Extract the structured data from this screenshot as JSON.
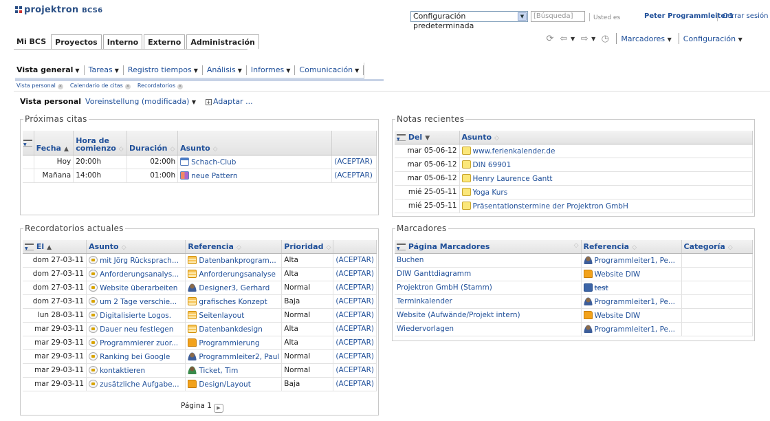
{
  "header": {
    "logo_text": "projektron",
    "logo_suffix": "BCS",
    "logo_version": "6",
    "profile_select": "Configuración predeterminada",
    "search_placeholder": "Búsqueda",
    "user_prefix": "Usted es",
    "user_name": "Peter Programmleiter1",
    "logout": "Cerrar sesión"
  },
  "main_tabs": [
    "Mi BCS",
    "Proyectos",
    "Interno",
    "Externo",
    "Administración"
  ],
  "toolbar": {
    "bookmarks": "Marcadores",
    "settings": "Configuración"
  },
  "subnav": [
    "Vista general",
    "Tareas",
    "Registro tiempos",
    "Análisis",
    "Informes",
    "Comunicación"
  ],
  "breadcrumbs": [
    "Vista personal",
    "Calendario de citas",
    "Recordatorios"
  ],
  "viewbar": {
    "title": "Vista personal",
    "preset": "Voreinstellung (modificada)",
    "adapt": "Adaptar ..."
  },
  "appointments": {
    "title": "Próximas citas",
    "headers": [
      "Fecha",
      "Hora de comienzo",
      "Duración",
      "Asunto"
    ],
    "rows": [
      {
        "date": "Hoy",
        "time": "20:00h",
        "duration": "02:00h",
        "subject": "Schach-Club",
        "action": "(ACEPTAR)"
      },
      {
        "date": "Mañana",
        "time": "14:00h",
        "duration": "01:00h",
        "subject": "neue Pattern",
        "action": "(ACEPTAR)"
      }
    ]
  },
  "notes": {
    "title": "Notas recientes",
    "headers": [
      "Del",
      "Asunto"
    ],
    "rows": [
      {
        "date": "mar 05-06-12",
        "subject": "www.ferienkalender.de"
      },
      {
        "date": "mar 05-06-12",
        "subject": "DIN 69901"
      },
      {
        "date": "mar 05-06-12",
        "subject": "Henry Laurence Gantt"
      },
      {
        "date": "mié 25-05-11",
        "subject": "Yoga Kurs"
      },
      {
        "date": "mié 25-05-11",
        "subject": "Präsentationstermine der Projektron GmbH"
      }
    ]
  },
  "reminders": {
    "title": "Recordatorios actuales",
    "headers": [
      "El",
      "Asunto",
      "Referencia",
      "Prioridad"
    ],
    "rows": [
      {
        "date": "dom 27-03-11",
        "subject": "mit Jörg Rücksprach...",
        "ref": "Datenbankprogram...",
        "ref_icon": "task-icon",
        "priority": "Alta",
        "action": "(ACEPTAR)"
      },
      {
        "date": "dom 27-03-11",
        "subject": "Anforderungsanalys...",
        "ref": "Anforderungsanalyse",
        "ref_icon": "task-icon",
        "priority": "Alta",
        "action": "(ACEPTAR)"
      },
      {
        "date": "dom 27-03-11",
        "subject": "Website überarbeiten",
        "ref": "Designer3, Gerhard",
        "ref_icon": "user-icon",
        "priority": "Normal",
        "action": "(ACEPTAR)"
      },
      {
        "date": "dom 27-03-11",
        "subject": "um 2 Tage verschie...",
        "ref": "grafisches Konzept",
        "ref_icon": "task-icon",
        "priority": "Baja",
        "action": "(ACEPTAR)"
      },
      {
        "date": "lun 28-03-11",
        "subject": "Digitalisierte Logos.",
        "ref": "Seitenlayout",
        "ref_icon": "task-icon",
        "priority": "Normal",
        "action": "(ACEPTAR)"
      },
      {
        "date": "mar 29-03-11",
        "subject": "Dauer neu festlegen",
        "ref": "Datenbankdesign",
        "ref_icon": "task-icon",
        "priority": "Alta",
        "action": "(ACEPTAR)"
      },
      {
        "date": "mar 29-03-11",
        "subject": "Programmierer zuor...",
        "ref": "Programmierung",
        "ref_icon": "folder-icon",
        "priority": "Alta",
        "action": "(ACEPTAR)"
      },
      {
        "date": "mar 29-03-11",
        "subject": "Ranking bei Google",
        "ref": "Programmleiter2, Paul",
        "ref_icon": "user-icon",
        "priority": "Normal",
        "action": "(ACEPTAR)"
      },
      {
        "date": "mar 29-03-11",
        "subject": "kontaktieren",
        "ref": "Ticket, Tim",
        "ref_icon": "ticket-user-icon",
        "priority": "Normal",
        "action": "(ACEPTAR)"
      },
      {
        "date": "mar 29-03-11",
        "subject": "zusätzliche Aufgabe...",
        "ref": "Design/Layout",
        "ref_icon": "folder-icon",
        "priority": "Baja",
        "action": "(ACEPTAR)"
      }
    ],
    "pager": "Página 1"
  },
  "bookmarks": {
    "title": "Marcadores",
    "headers": [
      "Página Marcadores",
      "Referencia",
      "Categoría"
    ],
    "rows": [
      {
        "page": "Buchen",
        "ref": "Programmleiter1, Pe...",
        "ref_icon": "user-icon",
        "category": ""
      },
      {
        "page": "DIW Ganttdiagramm",
        "ref": "Website DIW",
        "ref_icon": "folder-icon",
        "category": ""
      },
      {
        "page": "Projektron GmbH (Stamm)",
        "ref": "test",
        "ref_icon": "company-icon",
        "category": ""
      },
      {
        "page": "Terminkalender",
        "ref": "Programmleiter1, Pe...",
        "ref_icon": "user-icon",
        "category": ""
      },
      {
        "page": "Website (Aufwände/Projekt intern)",
        "ref": "Website DIW",
        "ref_icon": "folder-icon",
        "category": ""
      },
      {
        "page": "Wiedervorlagen",
        "ref": "Programmleiter1, Pe...",
        "ref_icon": "user-icon",
        "category": ""
      }
    ]
  }
}
